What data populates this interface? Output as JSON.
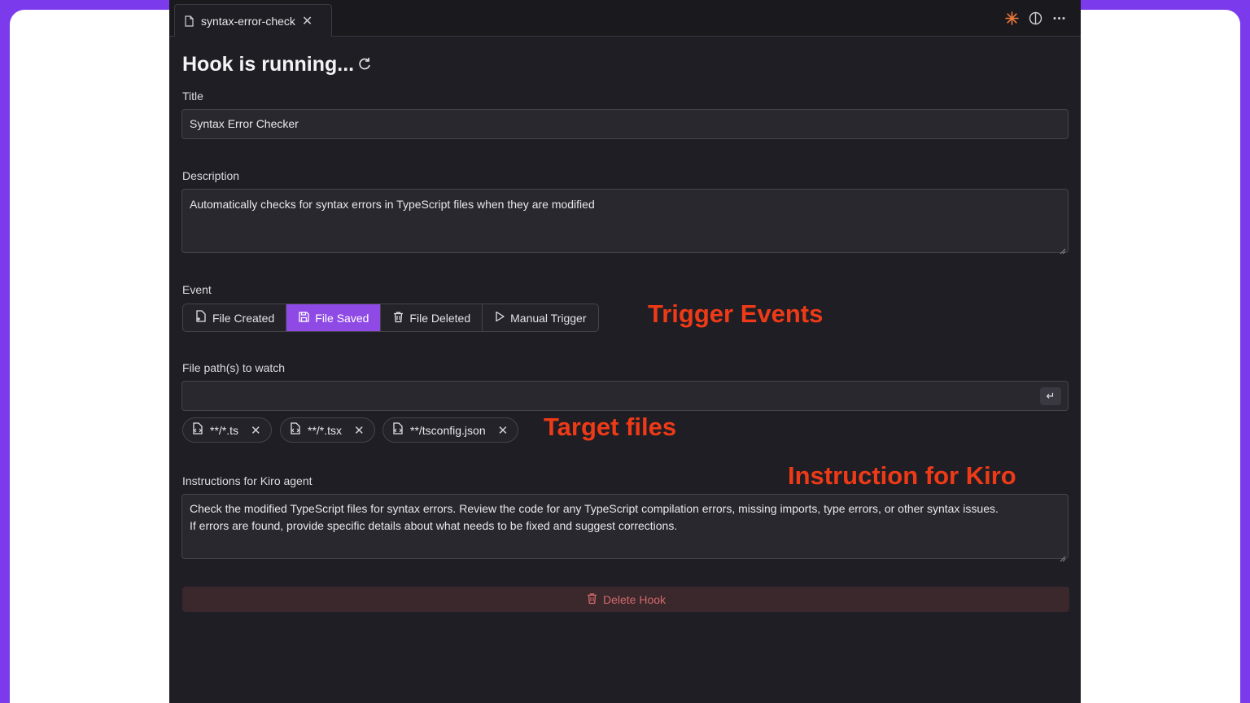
{
  "tab": {
    "label": "syntax-error-check"
  },
  "page": {
    "title": "Hook is running..."
  },
  "title_field": {
    "label": "Title",
    "value": "Syntax Error Checker"
  },
  "description_field": {
    "label": "Description",
    "value": "Automatically checks for syntax errors in TypeScript files when they are modified"
  },
  "event": {
    "label": "Event",
    "options": [
      {
        "label": "File Created",
        "icon": "file-plus-icon"
      },
      {
        "label": "File Saved",
        "icon": "save-icon",
        "active": true
      },
      {
        "label": "File Deleted",
        "icon": "trash-icon"
      },
      {
        "label": "Manual Trigger",
        "icon": "play-icon"
      }
    ]
  },
  "file_paths": {
    "label": "File path(s) to watch",
    "input_value": "",
    "patterns": [
      "**/*.ts",
      "**/*.tsx",
      "**/tsconfig.json"
    ]
  },
  "instructions": {
    "label": "Instructions for Kiro agent",
    "value_line1": "Check the modified TypeScript files for syntax errors. Review the code for any TypeScript compilation errors, missing imports, type errors, or other syntax issues.",
    "value_line2": "If errors are found, provide specific details about what needs to be fixed and suggest corrections."
  },
  "delete_button": {
    "label": "Delete Hook"
  },
  "annotations": {
    "trigger_events": "Trigger Events",
    "target_files": "Target files",
    "instruction_for_kiro": "Instruction for Kiro"
  },
  "colors": {
    "accent": "#8f4ae6",
    "frame": "#7c3aed",
    "annotation": "#ee3a17",
    "danger": "#d36a6a"
  }
}
